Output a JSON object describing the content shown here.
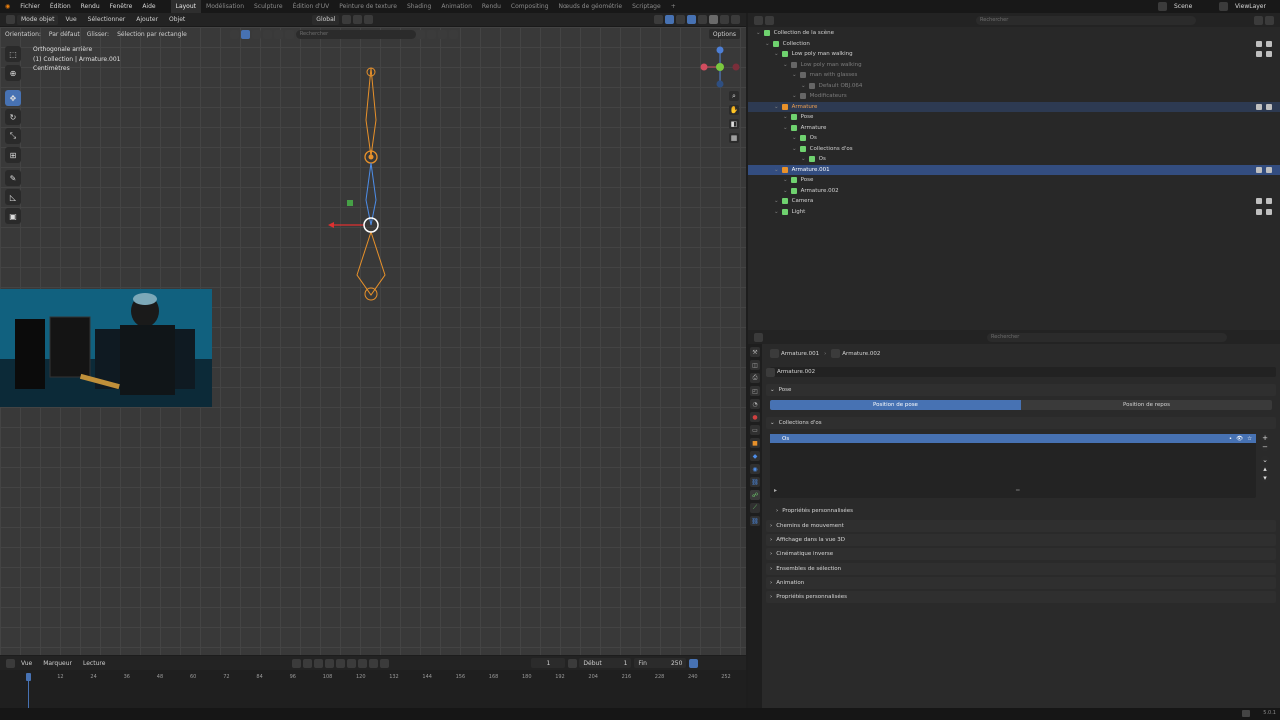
{
  "menu": {
    "items": [
      "Fichier",
      "Édition",
      "Rendu",
      "Fenêtre",
      "Aide"
    ],
    "workspaces": [
      "Layout",
      "Modélisation",
      "Sculpture",
      "Édition d'UV",
      "Peinture de texture",
      "Shading",
      "Animation",
      "Rendu",
      "Compositing",
      "Nœuds de géométrie",
      "Scriptage"
    ],
    "active_workspace": "Layout",
    "scene": "Scene",
    "viewlayer": "ViewLayer"
  },
  "viewport": {
    "mode": "Mode objet",
    "menu": [
      "Vue",
      "Sélectionner",
      "Ajouter",
      "Objet"
    ],
    "transform_orientation": "Global",
    "orientation_label": "Orientation:",
    "orientation_value": "Par défaut",
    "drag_label": "Glisser:",
    "drag_value": "Sélection par rectangle",
    "search_placeholder": "Rechercher",
    "options_label": "Options",
    "overlay_line1": "Orthogonale arrière",
    "overlay_line2": "(1) Collection | Armature.001",
    "overlay_line3": "Centimètres"
  },
  "timeline": {
    "menu": [
      "Vue",
      "Marqueur"
    ],
    "playback": "Lecture",
    "current_frame": "1",
    "start_label": "Début",
    "start": "1",
    "end_label": "Fin",
    "end": "250",
    "ticks": [
      "12",
      "24",
      "36",
      "48",
      "60",
      "72",
      "84",
      "96",
      "108",
      "120",
      "132",
      "144",
      "156",
      "168",
      "180",
      "192",
      "204",
      "216",
      "228",
      "240",
      "252"
    ]
  },
  "outliner": {
    "search_placeholder": "Rechercher",
    "rows": [
      {
        "label": "Collection de la scène",
        "indent": 0
      },
      {
        "label": "Collection",
        "indent": 1
      },
      {
        "label": "Low poly man walking",
        "indent": 2
      },
      {
        "label": "Low poly man walking",
        "indent": 3,
        "dim": true
      },
      {
        "label": "man with glasses",
        "indent": 4,
        "dim": true
      },
      {
        "label": "Default OBJ.064",
        "indent": 5,
        "dim": true
      },
      {
        "label": "Modificateurs",
        "indent": 4,
        "dim": true
      },
      {
        "label": "Armature",
        "indent": 2,
        "orange": true,
        "hl": true
      },
      {
        "label": "Pose",
        "indent": 3
      },
      {
        "label": "Armature",
        "indent": 3
      },
      {
        "label": "Os",
        "indent": 4
      },
      {
        "label": "Collections d'os",
        "indent": 4
      },
      {
        "label": "Os",
        "indent": 5
      },
      {
        "label": "Armature.001",
        "indent": 2,
        "orange": true,
        "sel": true
      },
      {
        "label": "Pose",
        "indent": 3
      },
      {
        "label": "Armature.002",
        "indent": 3
      },
      {
        "label": "Camera",
        "indent": 2
      },
      {
        "label": "Light",
        "indent": 2
      }
    ]
  },
  "properties": {
    "search_placeholder": "Rechercher",
    "breadcrumb_a": "Armature.001",
    "breadcrumb_b": "Armature.002",
    "data_name": "Armature.002",
    "pose_panel": "Pose",
    "pose_position": "Position de pose",
    "rest_position": "Position de repos",
    "bone_collections_panel": "Collections d'os",
    "bone_collection_item": "Os",
    "sub_custom_props": "Propriétés personnalisées",
    "panels": [
      "Chemins de mouvement",
      "Affichage dans la vue 3D",
      "Cinématique inverse",
      "Ensembles de sélection",
      "Animation",
      "Propriétés personnalisées"
    ]
  },
  "status": {
    "version": "5.0.1"
  },
  "colors": {
    "accent": "#4772b3",
    "bone_orange": "#e8912a",
    "selected_row": "#334d80"
  }
}
